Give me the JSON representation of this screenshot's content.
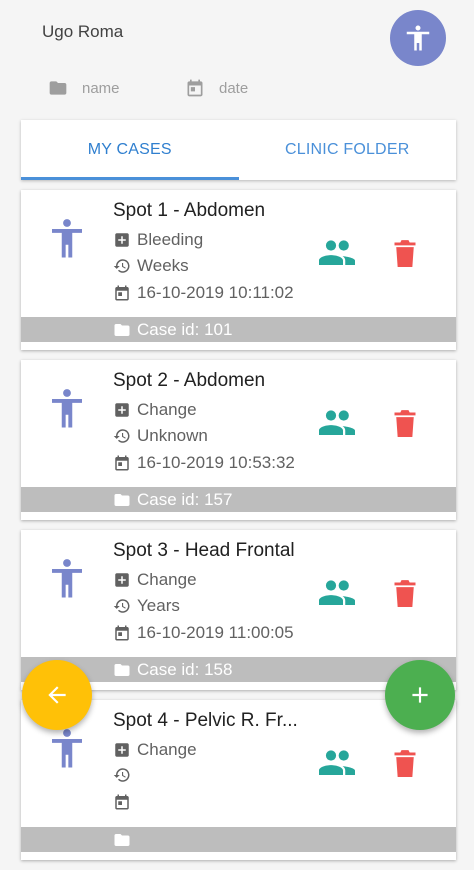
{
  "header": {
    "user_name": "Ugo Roma",
    "avatar_icon": "accessibility-icon",
    "sort_name_label": "name",
    "sort_date_label": "date"
  },
  "tabs": [
    {
      "label": "MY CASES",
      "active": true
    },
    {
      "label": "CLINIC FOLDER",
      "active": false
    }
  ],
  "cases": [
    {
      "title": "Spot 1 - Abdomen",
      "symptom": "Bleeding",
      "duration": "Weeks",
      "datetime": "16-10-2019 10:11:02",
      "case_id": "Case id: 101"
    },
    {
      "title": "Spot 2 - Abdomen",
      "symptom": "Change",
      "duration": "Unknown",
      "datetime": "16-10-2019 10:53:32",
      "case_id": "Case id: 157"
    },
    {
      "title": "Spot 3 - Head Frontal",
      "symptom": "Change",
      "duration": "Years",
      "datetime": "16-10-2019 11:00:05",
      "case_id": "Case id: 158"
    },
    {
      "title": "Spot 4 - Pelvic R. Fr...",
      "symptom": "Change",
      "duration": "",
      "datetime": "",
      "case_id": ""
    }
  ],
  "colors": {
    "accent_blue": "#4a90d9",
    "person_icon": "#7986cb",
    "share_icon": "#26a69a",
    "delete_icon": "#ef5350",
    "fab_back": "#ffc107",
    "fab_add": "#4caf50"
  },
  "fabs": {
    "back_icon": "arrow-left-icon",
    "add_icon": "plus-icon"
  }
}
